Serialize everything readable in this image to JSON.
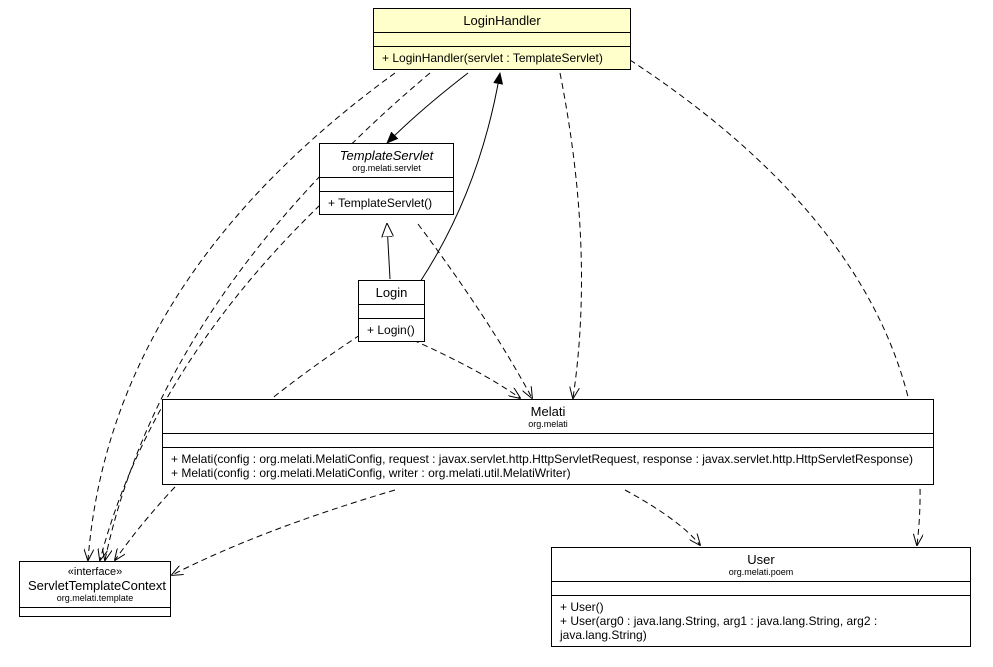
{
  "classes": {
    "loginHandler": {
      "name": "LoginHandler",
      "method1": "+ LoginHandler(servlet : TemplateServlet)"
    },
    "templateServlet": {
      "name": "TemplateServlet",
      "package": "org.melati.servlet",
      "method1": "+ TemplateServlet()"
    },
    "login": {
      "name": "Login",
      "method1": "+ Login()"
    },
    "melati": {
      "name": "Melati",
      "package": "org.melati",
      "method1": "+ Melati(config : org.melati.MelatiConfig, request : javax.servlet.http.HttpServletRequest, response : javax.servlet.http.HttpServletResponse)",
      "method2": "+ Melati(config : org.melati.MelatiConfig, writer : org.melati.util.MelatiWriter)"
    },
    "servletTemplateContext": {
      "stereotype": "«interface»",
      "name": "ServletTemplateContext",
      "package": "org.melati.template"
    },
    "user": {
      "name": "User",
      "package": "org.melati.poem",
      "method1": "+ User()",
      "method2": "+ User(arg0 : java.lang.String, arg1 : java.lang.String, arg2 : java.lang.String)"
    }
  },
  "chart_data": {
    "type": "uml-class-diagram",
    "nodes": [
      {
        "id": "LoginHandler",
        "stereotype": null,
        "package": null,
        "abstract": false,
        "highlighted": true,
        "methods": [
          "+ LoginHandler(servlet : TemplateServlet)"
        ]
      },
      {
        "id": "TemplateServlet",
        "stereotype": null,
        "package": "org.melati.servlet",
        "abstract": true,
        "highlighted": false,
        "methods": [
          "+ TemplateServlet()"
        ]
      },
      {
        "id": "Login",
        "stereotype": null,
        "package": null,
        "abstract": false,
        "highlighted": false,
        "methods": [
          "+ Login()"
        ]
      },
      {
        "id": "Melati",
        "stereotype": null,
        "package": "org.melati",
        "abstract": false,
        "highlighted": false,
        "methods": [
          "+ Melati(config : org.melati.MelatiConfig, request : javax.servlet.http.HttpServletRequest, response : javax.servlet.http.HttpServletResponse)",
          "+ Melati(config : org.melati.MelatiConfig, writer : org.melati.util.MelatiWriter)"
        ]
      },
      {
        "id": "ServletTemplateContext",
        "stereotype": "«interface»",
        "package": "org.melati.template",
        "abstract": false,
        "highlighted": false,
        "methods": []
      },
      {
        "id": "User",
        "stereotype": null,
        "package": "org.melati.poem",
        "abstract": false,
        "highlighted": false,
        "methods": [
          "+ User()",
          "+ User(arg0 : java.lang.String, arg1 : java.lang.String, arg2 : java.lang.String)"
        ]
      }
    ],
    "edges": [
      {
        "from": "LoginHandler",
        "to": "TemplateServlet",
        "type": "association",
        "style": "solid",
        "arrow": "filled"
      },
      {
        "from": "Login",
        "to": "TemplateServlet",
        "type": "generalization",
        "style": "solid",
        "arrow": "hollow"
      },
      {
        "from": "Login",
        "to": "LoginHandler",
        "type": "association",
        "style": "solid",
        "arrow": "filled"
      },
      {
        "from": "LoginHandler",
        "to": "Melati",
        "type": "dependency",
        "style": "dashed",
        "arrow": "open"
      },
      {
        "from": "TemplateServlet",
        "to": "Melati",
        "type": "dependency",
        "style": "dashed",
        "arrow": "open"
      },
      {
        "from": "Login",
        "to": "Melati",
        "type": "dependency",
        "style": "dashed",
        "arrow": "open"
      },
      {
        "from": "LoginHandler",
        "to": "ServletTemplateContext",
        "type": "dependency",
        "style": "dashed",
        "arrow": "open"
      },
      {
        "from": "TemplateServlet",
        "to": "ServletTemplateContext",
        "type": "dependency",
        "style": "dashed",
        "arrow": "open"
      },
      {
        "from": "Login",
        "to": "ServletTemplateContext",
        "type": "dependency",
        "style": "dashed",
        "arrow": "open"
      },
      {
        "from": "Melati",
        "to": "ServletTemplateContext",
        "type": "dependency",
        "style": "dashed",
        "arrow": "open"
      },
      {
        "from": "LoginHandler",
        "to": "User",
        "type": "dependency",
        "style": "dashed",
        "arrow": "open"
      },
      {
        "from": "Melati",
        "to": "User",
        "type": "dependency",
        "style": "dashed",
        "arrow": "open"
      }
    ]
  }
}
